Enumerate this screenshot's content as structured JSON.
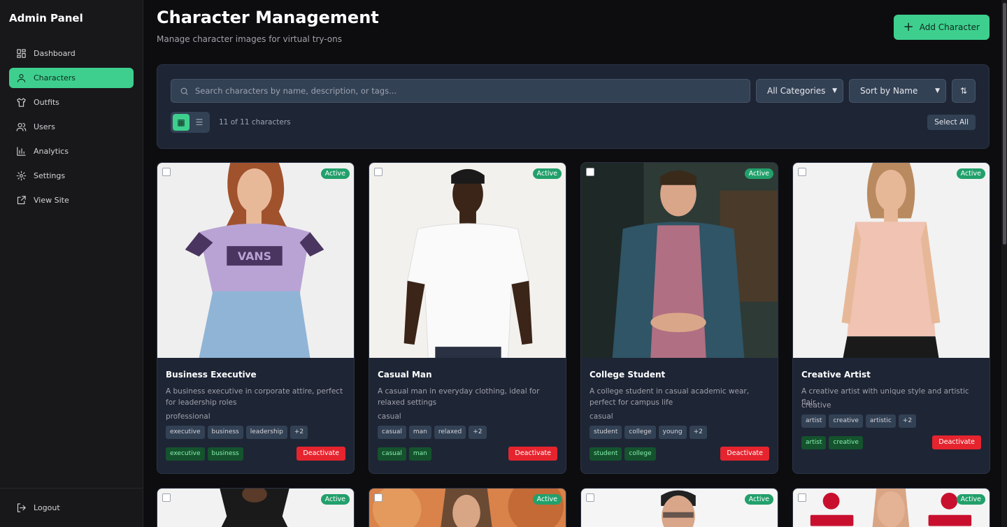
{
  "sidebar": {
    "title": "Admin Panel",
    "items": [
      {
        "label": "Dashboard",
        "icon": "grid-icon"
      },
      {
        "label": "Characters",
        "icon": "user-icon",
        "active": true
      },
      {
        "label": "Outfits",
        "icon": "shirt-icon"
      },
      {
        "label": "Users",
        "icon": "users-icon"
      },
      {
        "label": "Analytics",
        "icon": "bar-chart-icon"
      },
      {
        "label": "Settings",
        "icon": "gear-icon"
      },
      {
        "label": "View Site",
        "icon": "external-link-icon"
      }
    ],
    "logout_label": "Logout"
  },
  "header": {
    "title": "Character Management",
    "subtitle": "Manage character images for virtual try-ons",
    "add_button": "Add Character"
  },
  "filters": {
    "search_placeholder": "Search characters by name, description, or tags...",
    "category_selected": "All Categories",
    "sort_selected": "Sort by Name",
    "count_text": "11 of 11 characters",
    "select_all": "Select All"
  },
  "colors": {
    "accent": "#3ecf8e",
    "danger": "#e5242e",
    "active_badge": "#22a06b"
  },
  "cards": [
    {
      "name": "Business Executive",
      "status": "Active",
      "description": "A business executive in corporate attire, perfect for leadership roles",
      "category": "professional",
      "tags": [
        "executive",
        "business",
        "leadership",
        "+2"
      ],
      "green_tags": [
        "executive",
        "business"
      ],
      "action": "Deactivate"
    },
    {
      "name": "Casual Man",
      "status": "Active",
      "description": "A casual man in everyday clothing, ideal for relaxed settings",
      "category": "casual",
      "tags": [
        "casual",
        "man",
        "relaxed",
        "+2"
      ],
      "green_tags": [
        "casual",
        "man"
      ],
      "action": "Deactivate"
    },
    {
      "name": "College Student",
      "status": "Active",
      "description": "A college student in casual academic wear, perfect for campus life",
      "category": "casual",
      "tags": [
        "student",
        "college",
        "young",
        "+2"
      ],
      "green_tags": [
        "student",
        "college"
      ],
      "action": "Deactivate"
    },
    {
      "name": "Creative Artist",
      "status": "Active",
      "description": "A creative artist with unique style and artistic flair",
      "category": "creative",
      "tags": [
        "artist",
        "creative",
        "artistic",
        "+2"
      ],
      "green_tags": [
        "artist",
        "creative"
      ],
      "action": "Deactivate"
    }
  ],
  "row2_badges": [
    "Active",
    "Active",
    "Active",
    "Active"
  ]
}
